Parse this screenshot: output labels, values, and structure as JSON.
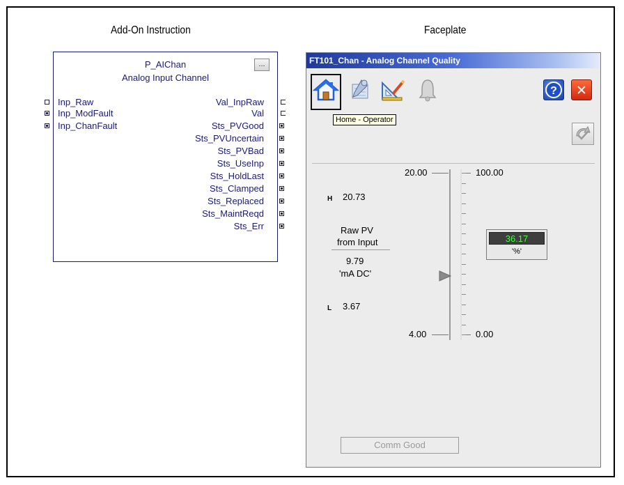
{
  "headings": {
    "left": "Add-On Instruction",
    "right": "Faceplate"
  },
  "aoi": {
    "title": "P_AIChan",
    "subtitle": "Analog Input Channel",
    "config_button": "...",
    "inputs": [
      "Inp_Raw",
      "Inp_ModFault",
      "Inp_ChanFault"
    ],
    "outputs": [
      "Val_InpRaw",
      "Val",
      "Sts_PVGood",
      "Sts_PVUncertain",
      "Sts_PVBad",
      "Sts_UseInp",
      "Sts_HoldLast",
      "Sts_Clamped",
      "Sts_Replaced",
      "Sts_MaintReqd",
      "Sts_Err"
    ]
  },
  "faceplate": {
    "title": "FT101_Chan - Analog Channel Quality",
    "toolbar": {
      "home_icon": "home-icon",
      "maintenance_icon": "maintenance-icon",
      "engineering_icon": "engineering-icon",
      "alarm_icon": "bell-icon",
      "help_label": "?",
      "close_label": "✕"
    },
    "tooltip": "Home - Operator",
    "high_limit": {
      "marker": "H",
      "value": "20.73"
    },
    "low_limit": {
      "marker": "L",
      "value": "3.67"
    },
    "raw_pv_label_1": "Raw PV",
    "raw_pv_label_2": "from Input",
    "raw_value": "9.79",
    "raw_unit": "'mA DC'",
    "scale": {
      "raw_max": "20.00",
      "raw_min": "4.00",
      "eu_max": "100.00",
      "eu_min": "0.00"
    },
    "pv_value": "36.17",
    "pv_unit": "'%'",
    "pv_percent": 36.17,
    "comm_status": "Comm Good",
    "colors": {
      "pv_text": "#3cff3c",
      "title_bar": "#1f3a9a"
    }
  }
}
